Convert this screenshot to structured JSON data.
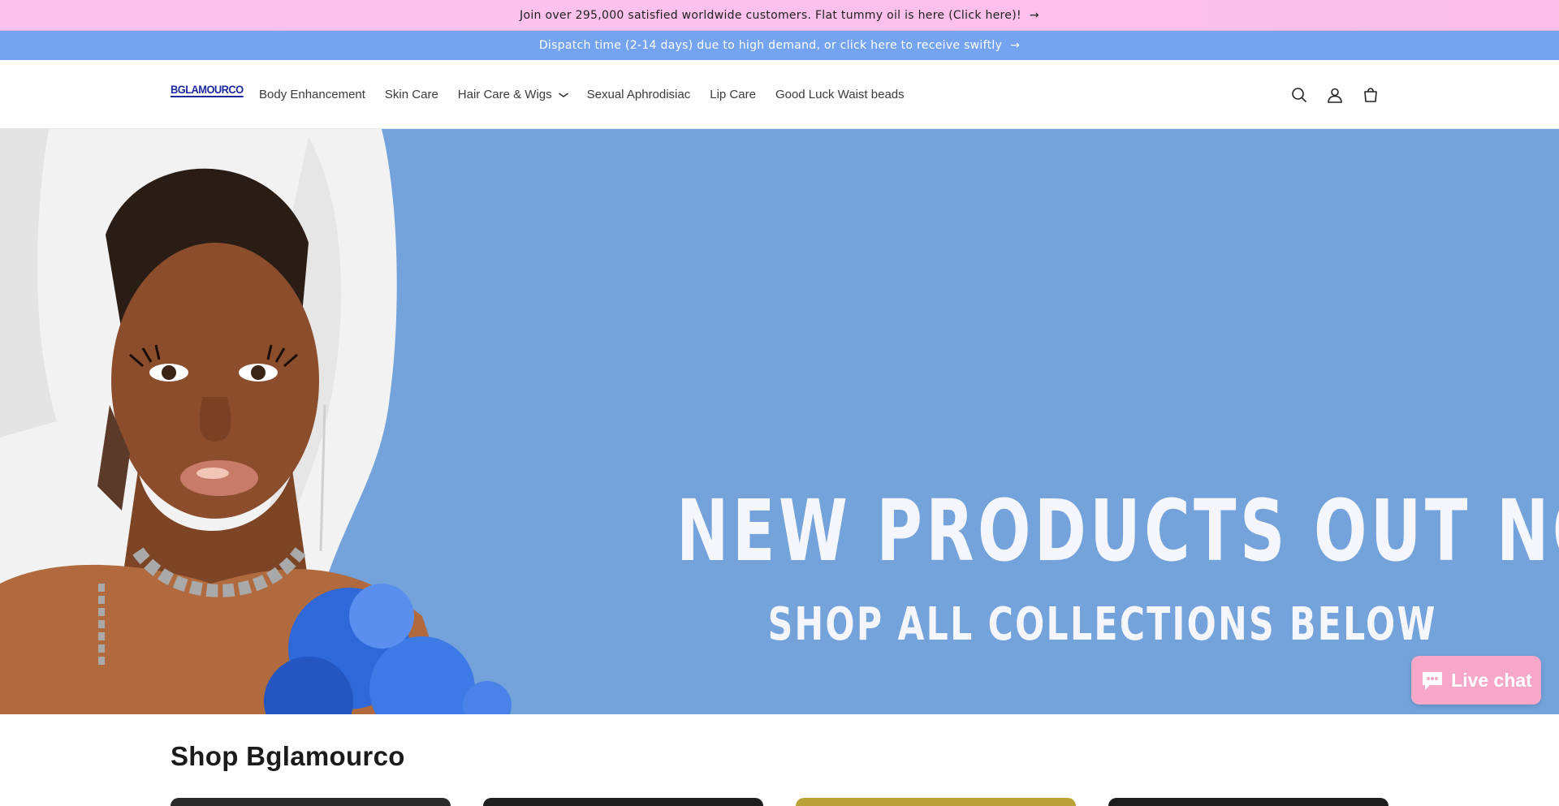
{
  "announcements": [
    {
      "text": "Join over 295,000 satisfied worldwide customers. Flat tummy oil is here (Click here)!",
      "arrow": "→"
    },
    {
      "text": "Dispatch time (2-14 days) due to high demand, or click here to receive swiftly",
      "arrow": "→"
    }
  ],
  "header": {
    "logo": "BGLAMOURCO",
    "nav": [
      {
        "label": "Body Enhancement"
      },
      {
        "label": "Skin Care"
      },
      {
        "label": "Hair Care & Wigs",
        "dropdown": true
      },
      {
        "label": "Sexual Aphrodisiac"
      },
      {
        "label": "Lip Care"
      },
      {
        "label": "Good Luck Waist beads"
      }
    ],
    "icons": [
      "search-icon",
      "account-icon",
      "cart-icon"
    ]
  },
  "hero": {
    "headline": "NEW PRODUCTS OUT NOW",
    "subline": "SHOP ALL COLLECTIONS BELOW",
    "background": "#74a3db"
  },
  "live_chat": {
    "label": "Live chat",
    "color": "#f7a8c9"
  },
  "shop": {
    "title": "Shop Bglamourco"
  },
  "colors": {
    "pink_bar": "#fdc3ee",
    "blue_bar": "#74a4f0",
    "logo": "#1c2a9c"
  }
}
